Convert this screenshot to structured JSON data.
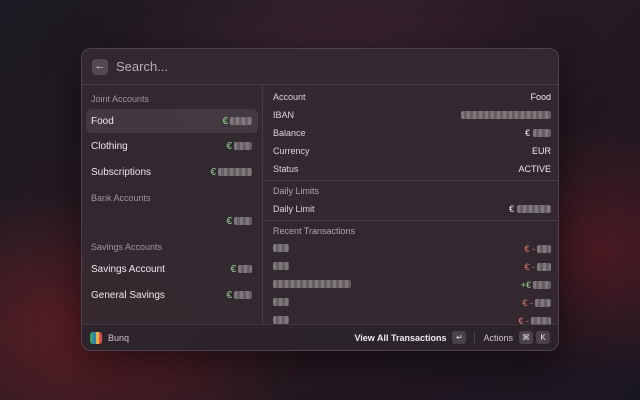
{
  "search": {
    "placeholder": "Search..."
  },
  "sections": {
    "joint": "Joint Accounts",
    "bank": "Bank Accounts",
    "savings": "Savings Accounts"
  },
  "accounts": {
    "joint": [
      {
        "label": "Food",
        "currency_symbol": "€"
      },
      {
        "label": "Clothing",
        "currency_symbol": "€"
      },
      {
        "label": "Subscriptions",
        "currency_symbol": "€"
      }
    ],
    "bank": [
      {
        "label": "",
        "currency_symbol": "€"
      }
    ],
    "savings": [
      {
        "label": "Savings Account",
        "currency_symbol": "€"
      },
      {
        "label": "General Savings",
        "currency_symbol": "€"
      }
    ]
  },
  "details": {
    "account_key": "Account",
    "account_value": "Food",
    "iban_key": "IBAN",
    "balance_key": "Balance",
    "balance_symbol": "€",
    "currency_key": "Currency",
    "currency_value": "EUR",
    "status_key": "Status",
    "status_value": "ACTIVE",
    "daily_limits_label": "Daily Limits",
    "daily_limit_key": "Daily Limit",
    "daily_limit_symbol": "€",
    "recent_label": "Recent Transactions",
    "transactions": [
      {
        "sign": "€ -"
      },
      {
        "sign": "€ -"
      },
      {
        "sign": "+€"
      },
      {
        "sign": "€ -"
      },
      {
        "sign": "€ -"
      }
    ]
  },
  "footer": {
    "app_name": "Bunq",
    "primary_action": "View All Transactions",
    "enter_key": "↵",
    "actions_label": "Actions",
    "cmd_key": "⌘",
    "k_key": "K"
  },
  "colors": {
    "positive": "#8fd18b",
    "negative": "#e07a6c",
    "app_icon_stripes": [
      "#3aa35a",
      "#2f7fbf",
      "#e3b23c",
      "#d9534f"
    ]
  },
  "icons": {
    "back": "arrow-left-icon",
    "enter": "return-icon",
    "command": "command-icon"
  }
}
